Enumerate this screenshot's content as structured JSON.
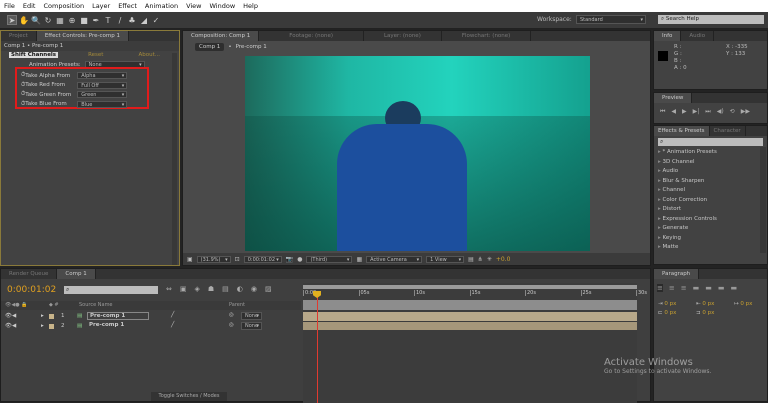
{
  "menu": [
    "File",
    "Edit",
    "Composition",
    "Layer",
    "Effect",
    "Animation",
    "View",
    "Window",
    "Help"
  ],
  "toolbar": {
    "workspace_label": "Workspace:",
    "workspace_value": "Standard",
    "search_placeholder": "Search Help"
  },
  "left_panel": {
    "tabs": [
      "Project",
      "Effect Controls: Pre-comp 1"
    ],
    "breadcrumb": "Comp 1 • Pre-comp 1",
    "effect_name": "Shift Channels",
    "reset": "Reset",
    "about": "About...",
    "presets_label": "Animation Presets:",
    "presets_value": "None",
    "params": [
      {
        "label": "Take Alpha From",
        "value": "Alpha"
      },
      {
        "label": "Take Red From",
        "value": "Full Off"
      },
      {
        "label": "Take Green From",
        "value": "Green"
      },
      {
        "label": "Take Blue From",
        "value": "Blue"
      }
    ],
    "highlight_color": "#e01b1b"
  },
  "comp_panel": {
    "tabs": [
      "Composition: Comp 1",
      "Footage: (none)",
      "Layer: (none)",
      "Flowchart: (none)"
    ],
    "crumbs": [
      "Comp 1",
      "Pre-comp 1"
    ],
    "zoom": "(31.9%)",
    "timecode": "0:00:01:02",
    "resolution": "(Third)",
    "camera": "Active Camera",
    "views": "1 View",
    "exposure": "+0.0"
  },
  "info": {
    "tabs": [
      "Info",
      "Audio"
    ],
    "r": "R :",
    "g": "G :",
    "b": "B :",
    "a": "A : 0",
    "x": "X : -335",
    "y": "Y : 133"
  },
  "preview": {
    "tab": "Preview"
  },
  "effects": {
    "tabs": [
      "Effects & Presets",
      "Character"
    ],
    "items": [
      "* Animation Presets",
      "3D Channel",
      "Audio",
      "Blur & Sharpen",
      "Channel",
      "Color Correction",
      "Distort",
      "Expression Controls",
      "Generate",
      "Keying",
      "Matte"
    ]
  },
  "paragraph": {
    "tab": "Paragraph",
    "values": [
      "0 px",
      "0 px",
      "0 px",
      "0 px",
      "0 px"
    ]
  },
  "timeline": {
    "tabs": [
      "Render Queue",
      "Comp 1"
    ],
    "timecode": "0:00:01:02",
    "col_source": "Source Name",
    "col_parent": "Parent",
    "ticks": [
      "0:00s",
      "05s",
      "10s",
      "15s",
      "20s",
      "25s",
      "30s"
    ],
    "layers": [
      {
        "num": "1",
        "name": "Pre-comp 1",
        "parent": "None"
      },
      {
        "num": "2",
        "name": "Pre-comp 1",
        "parent": "None"
      }
    ],
    "toggle": "Toggle Switches / Modes"
  },
  "watermark": {
    "title": "Activate Windows",
    "sub": "Go to Settings to activate Windows."
  }
}
